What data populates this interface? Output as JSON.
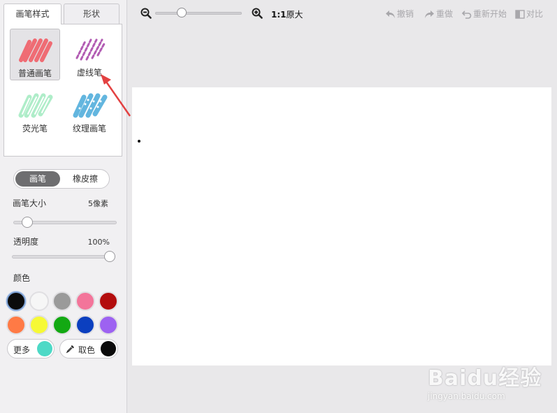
{
  "left_panel": {
    "tabs": [
      {
        "label": "画笔样式",
        "active": true
      },
      {
        "label": "形状",
        "active": false
      }
    ],
    "brushes": [
      {
        "label": "普通画笔",
        "icon": "solid-brush-icon",
        "color": "#ef6c74",
        "selected": true
      },
      {
        "label": "虚线笔",
        "icon": "dashed-brush-icon",
        "color": "#b25cb3",
        "selected": false
      },
      {
        "label": "荧光笔",
        "icon": "highlighter-brush-icon",
        "color": "#a7ecc4",
        "selected": false
      },
      {
        "label": "纹理画笔",
        "icon": "texture-brush-icon",
        "color": "#63b6df",
        "selected": false
      }
    ],
    "mode_toggle": {
      "active": "画笔",
      "inactive": "橡皮擦"
    },
    "brush_size": {
      "label": "画笔大小",
      "value_text": "5像素",
      "level": 0.05
    },
    "opacity": {
      "label": "透明度",
      "value_text": "100%",
      "level": 1.0
    },
    "color_label": "颜色",
    "swatches": [
      [
        "#0b0b0b",
        "#f6f6f6",
        "#9a9a9a",
        "#f3759a",
        "#b30d0d"
      ],
      [
        "#ff7a45",
        "#f6f935",
        "#13a913",
        "#0b3fbf",
        "#9d62f1"
      ]
    ],
    "selected_swatch": "#0b0b0b",
    "more": {
      "label": "更多",
      "color": "#4dd9c6"
    },
    "pick": {
      "label": "取色",
      "icon": "eyedropper-icon",
      "color": "#0b0b0b"
    }
  },
  "toolbar": {
    "zoom_out_icon": "zoom-out-icon",
    "zoom_in_icon": "zoom-in-icon",
    "zoom_ratio": "1:1",
    "zoom_label": "原大",
    "undo": "撤销",
    "redo": "重做",
    "restart": "重新开始",
    "compare": "对比"
  },
  "watermark": {
    "logo": "Baidu经验",
    "url": "jingyan.baidu.com"
  }
}
